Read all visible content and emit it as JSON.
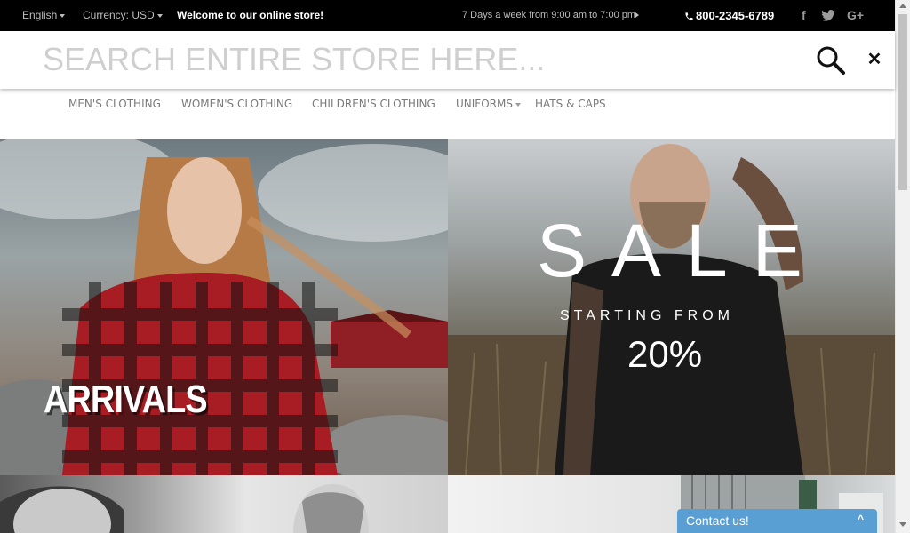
{
  "topbar": {
    "language": "English",
    "currency": "Currency: USD",
    "welcome": "Welcome to our online store!",
    "hours": "7 Days a week from 9:00 am to 7:00 pm",
    "phone": "800-2345-6789",
    "social": {
      "facebook": "f",
      "twitter": "t",
      "googleplus": "G+"
    }
  },
  "search": {
    "placeholder": "SEARCH ENTIRE STORE HERE...",
    "value": ""
  },
  "nav": {
    "items": [
      {
        "label": "MEN'S CLOTHING"
      },
      {
        "label": "WOMEN'S CLOTHING"
      },
      {
        "label": "CHILDREN'S CLOTHING"
      },
      {
        "label": "UNIFORMS"
      },
      {
        "label": "HATS & CAPS"
      }
    ]
  },
  "hero": {
    "left": {
      "title": "ARRIVALS"
    },
    "right": {
      "title": "SALE",
      "subtitle": "STARTING FROM",
      "percent": "20%"
    }
  },
  "contact_widget": {
    "label": "Contact us!",
    "chevron": "^"
  },
  "colors": {
    "topbar_bg": "#000000",
    "contact_accent": "#5a9fd4",
    "nav_text": "#7a7a7a"
  },
  "icons": [
    "caret-down-icon",
    "phone-icon",
    "facebook-icon",
    "twitter-icon",
    "google-plus-icon",
    "search-icon",
    "close-icon",
    "chevron-up-icon"
  ]
}
